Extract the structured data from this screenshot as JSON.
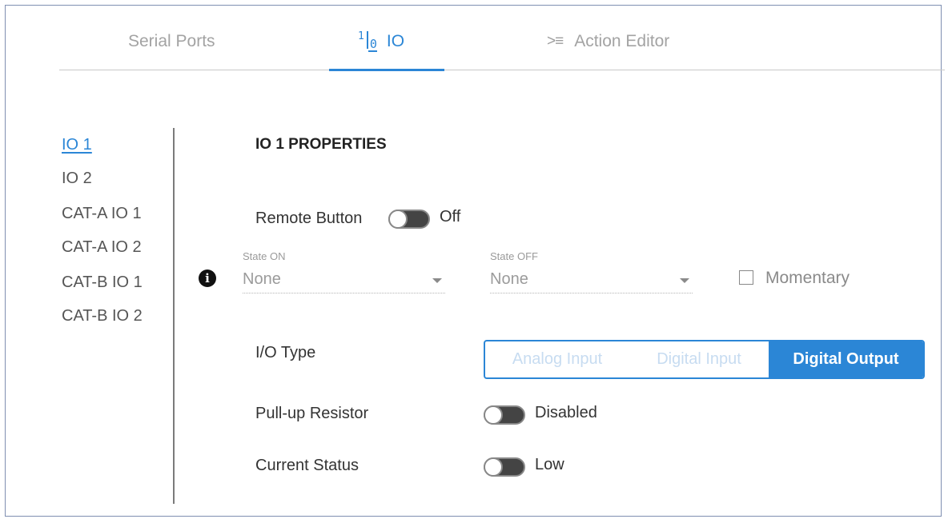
{
  "tabs": [
    {
      "label": "Serial Ports",
      "icon": ""
    },
    {
      "label": "IO",
      "icon": "io-icon",
      "active": true
    },
    {
      "label": "Action Editor",
      "icon": "action-editor-icon"
    }
  ],
  "nav": {
    "items": [
      "IO 1",
      "IO 2",
      "CAT-A IO 1",
      "CAT-A IO 2",
      "CAT-B IO 1",
      "CAT-B IO 2"
    ],
    "active_index": 0
  },
  "properties": {
    "title": "IO 1 PROPERTIES",
    "remote_button": {
      "label": "Remote Button",
      "state": "Off"
    },
    "state_on": {
      "caption": "State ON",
      "value": "None"
    },
    "state_off": {
      "caption": "State OFF",
      "value": "None"
    },
    "momentary": {
      "label": "Momentary",
      "checked": false
    },
    "io_type": {
      "label": "I/O Type",
      "options": [
        "Analog Input",
        "Digital Input",
        "Digital Output"
      ],
      "selected": "Digital Output"
    },
    "pull_up": {
      "label": "Pull-up Resistor",
      "state": "Disabled"
    },
    "current_status": {
      "label": "Current Status",
      "state": "Low"
    }
  },
  "colors": {
    "accent": "#2b86d6",
    "border": "#7f8fb1"
  }
}
